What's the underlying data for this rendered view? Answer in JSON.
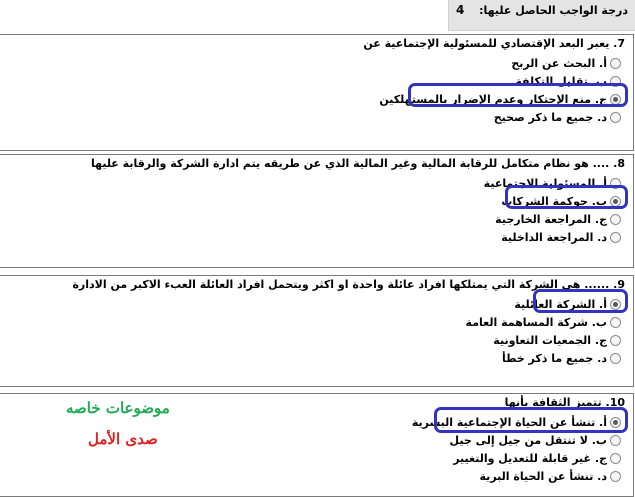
{
  "header": {
    "grade_label": "درجة الواجب الحاصل عليها:",
    "grade_value": "4"
  },
  "questions": [
    {
      "text": "7. يعبر البعد الإقتصادي للمسئولية الإجتماعية عن",
      "options": [
        {
          "label": "أ. البحث عن الربح",
          "selected": false
        },
        {
          "label": "ب. تقليل التكلفة",
          "selected": false
        },
        {
          "label": "ج. منع الإحتكار وعدم الإضرار بالمستهلكين",
          "selected": true
        },
        {
          "label": "د. جميع ما ذكر صحيح",
          "selected": false
        }
      ]
    },
    {
      "text": "8. .... هو نظام متكامل للرقابة المالية وغير المالية الذي عن طريقه يتم ادارة الشركة والرقابة عليها",
      "options": [
        {
          "label": "أ. المسئولية الاجتماعية",
          "selected": false
        },
        {
          "label": "ب. حوكمة الشركات",
          "selected": true
        },
        {
          "label": "ج. المراجعة الخارجية",
          "selected": false
        },
        {
          "label": "د. المراجعة الداخلية",
          "selected": false
        }
      ]
    },
    {
      "text": "9. ...... هي الشركة التي يمتلكها افراد عائلة واحدة او اكثر ويتحمل افراد العائلة العبء الاكبر من الادارة",
      "options": [
        {
          "label": "أ. الشركة العائلية",
          "selected": true
        },
        {
          "label": "ب. شركة المساهمة العامة",
          "selected": false
        },
        {
          "label": "ج. الجمعيات التعاونية",
          "selected": false
        },
        {
          "label": "د. جميع ما ذكر خطأ",
          "selected": false
        }
      ]
    },
    {
      "text": "10. تتميز الثقافة بأنها",
      "options": [
        {
          "label": "أ. تنشأ عن الحياة الإجتماعية البشرية",
          "selected": true
        },
        {
          "label": "ب. لا تنتقل من جيل إلى جيل",
          "selected": false
        },
        {
          "label": "ج. غير قابلة للتعديل والتغيير",
          "selected": false
        },
        {
          "label": "د. تنشأ عن الحياة البرية",
          "selected": false
        }
      ]
    }
  ],
  "watermark": {
    "line1": "موضوعات خاصه",
    "line2": "صدى الأمل"
  },
  "colors": {
    "highlight": "#3333bb",
    "watermark_green": "#22aa55",
    "watermark_red": "#dd2222"
  }
}
